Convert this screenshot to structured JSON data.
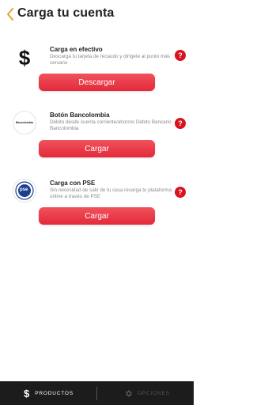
{
  "header": {
    "title": "Carga tu cuenta"
  },
  "options": [
    {
      "title": "Carga en efectivo",
      "description": "Descarga tu tarjeta de recaudo y dirígete al punto más cercano",
      "button_label": "Descargar",
      "logo": "dollar-sign-icon"
    },
    {
      "title": "Botón Bancolombia",
      "description": "Débito desde cuenta corriente/ahorros Débito Bancario Bancolombia",
      "button_label": "Cargar",
      "logo": "bancolombia-logo",
      "logo_text": "Bancolombia"
    },
    {
      "title": "Carga con PSE",
      "description": "Sin necesidad de salir de tu casa recarga tu plataforma online a través de PSE",
      "button_label": "Cargar",
      "logo": "pse-logo",
      "logo_text": "pse"
    }
  ],
  "help_label": "?",
  "bottom_nav": {
    "products_label": "PRODUCTOS",
    "options_label": "OPCIONES"
  },
  "colors": {
    "accent": "#e4293a",
    "back_arrow": "#e8a030",
    "nav_bg": "#1c1c1c"
  }
}
